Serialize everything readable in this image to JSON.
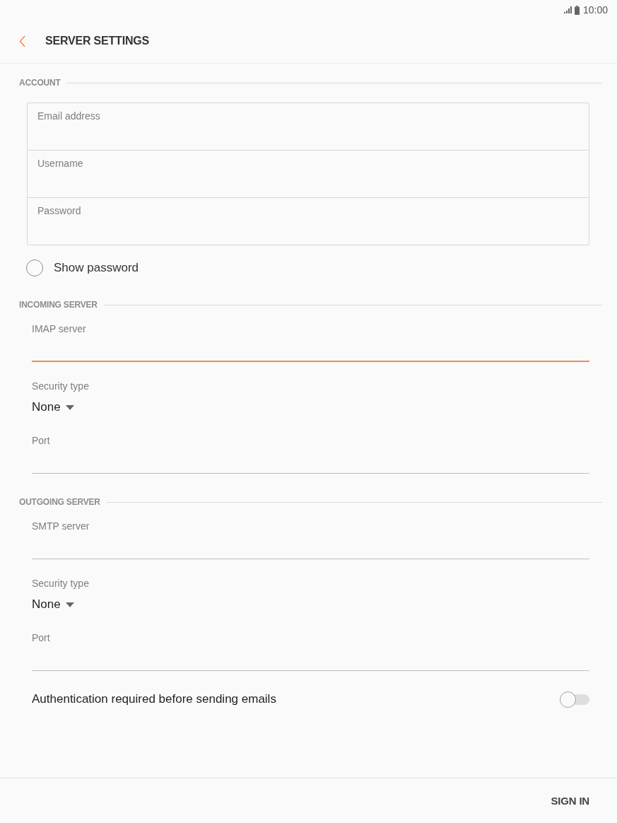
{
  "status_bar": {
    "time": "10:00"
  },
  "app_bar": {
    "title": "SERVER SETTINGS"
  },
  "sections": [
    {
      "kind": "account",
      "title": "ACCOUNT",
      "fields": [
        {
          "placeholder": "Email address"
        },
        {
          "placeholder": "Username"
        },
        {
          "placeholder": "Password"
        }
      ],
      "show_password": {
        "label": "Show password",
        "checked": false
      }
    },
    {
      "kind": "server",
      "title": "INCOMING SERVER",
      "fields": [
        {
          "kind": "text",
          "label": "IMAP server",
          "focused": true
        },
        {
          "kind": "select",
          "label": "Security type",
          "value": "None"
        },
        {
          "kind": "text",
          "label": "Port",
          "focused": false
        }
      ]
    },
    {
      "kind": "server",
      "title": "OUTGOING SERVER",
      "fields": [
        {
          "kind": "text",
          "label": "SMTP server",
          "focused": false
        },
        {
          "kind": "select",
          "label": "Security type",
          "value": "None"
        },
        {
          "kind": "text",
          "label": "Port",
          "focused": false
        }
      ],
      "authentication": {
        "label": "Authentication required before sending emails",
        "on": false
      }
    }
  ],
  "footer": {
    "button": "SIGN IN"
  }
}
